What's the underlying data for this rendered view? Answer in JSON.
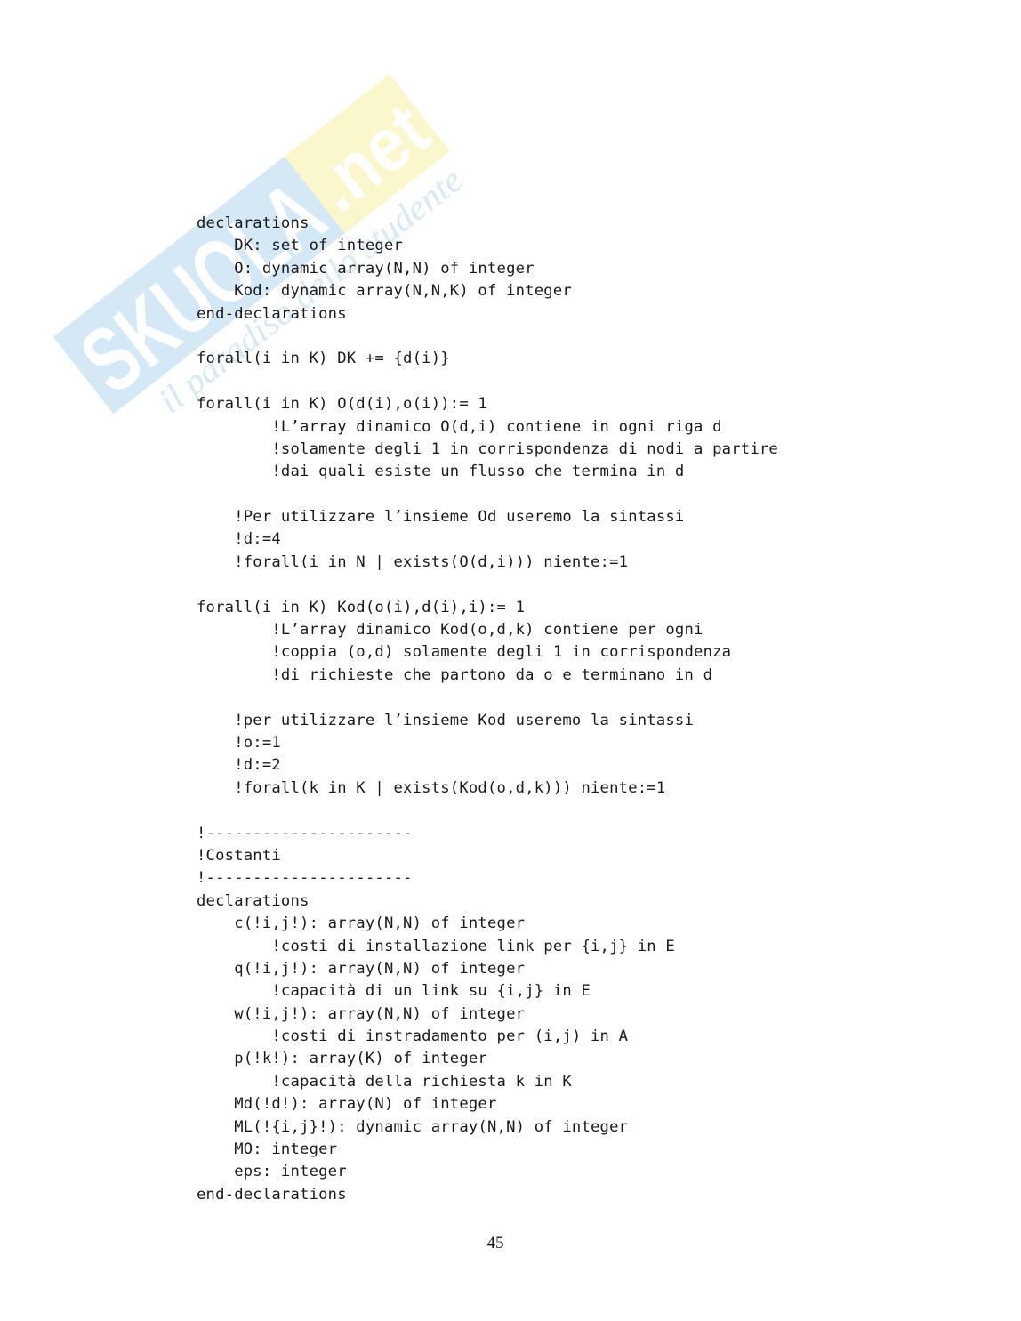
{
  "watermark": {
    "brand_text": "SKUOLA",
    "brand_suffix": ".net",
    "tagline": "il paradiso dello studente",
    "colors": {
      "blue": "#cfe6f3",
      "yellow": "#fbf6c7",
      "tagline": "#d8ebf5"
    }
  },
  "code_lines": [
    "declarations",
    "    DK: set of integer",
    "    O: dynamic array(N,N) of integer",
    "    Kod: dynamic array(N,N,K) of integer",
    "end-declarations",
    "",
    "forall(i in K) DK += {d(i)}",
    "",
    "forall(i in K) O(d(i),o(i)):= 1",
    "        !L’array dinamico O(d,i) contiene in ogni riga d",
    "        !solamente degli 1 in corrispondenza di nodi a partire",
    "        !dai quali esiste un flusso che termina in d",
    "",
    "    !Per utilizzare l’insieme Od useremo la sintassi",
    "    !d:=4",
    "    !forall(i in N | exists(O(d,i))) niente:=1",
    "",
    "forall(i in K) Kod(o(i),d(i),i):= 1",
    "        !L’array dinamico Kod(o,d,k) contiene per ogni",
    "        !coppia (o,d) solamente degli 1 in corrispondenza",
    "        !di richieste che partono da o e terminano in d",
    "",
    "    !per utilizzare l’insieme Kod useremo la sintassi",
    "    !o:=1",
    "    !d:=2",
    "    !forall(k in K | exists(Kod(o,d,k))) niente:=1",
    "",
    "!----------------------",
    "!Costanti",
    "!----------------------",
    "declarations",
    "    c(!i,j!): array(N,N) of integer",
    "        !costi di installazione link per {i,j} in E",
    "    q(!i,j!): array(N,N) of integer",
    "        !capacità di un link su {i,j} in E",
    "    w(!i,j!): array(N,N) of integer",
    "        !costi di instradamento per (i,j) in A",
    "    p(!k!): array(K) of integer",
    "        !capacità della richiesta k in K",
    "    Md(!d!): array(N) of integer",
    "    ML(!{i,j}!): dynamic array(N,N) of integer",
    "    MO: integer",
    "    eps: integer",
    "end-declarations"
  ],
  "page_number": "45"
}
